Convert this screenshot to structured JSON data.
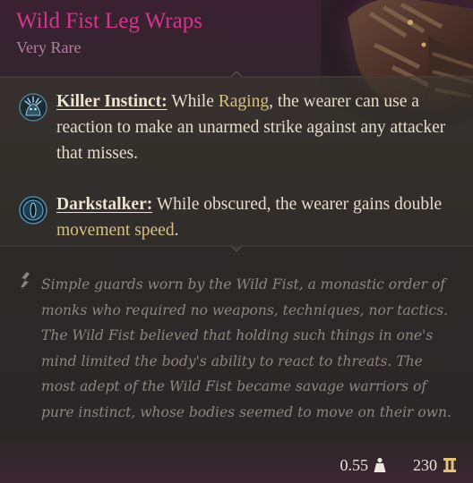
{
  "item": {
    "name": "Wild Fist Leg Wraps",
    "rarity": "Very Rare"
  },
  "passives": [
    {
      "icon": "killer-instinct-icon",
      "name": "Killer Instinct:",
      "pre": " While ",
      "keyword": "Raging",
      "post": ", the wearer can use a reaction to make an unarmed strike against any attacker that misses."
    },
    {
      "icon": "darkstalker-eye-icon",
      "name": "Darkstalker:",
      "pre": " While obscured, the wearer gains double ",
      "keyword": "movement speed",
      "post": "."
    }
  ],
  "lore": "Simple guards worn by the Wild Fist, a monastic order of monks who required no weapons, techniques, nor tactics. The Wild Fist believed that holding such things in one's mind limited the body's ability to react to threats. The most adept of the Wild Fist became savage warriors of pure instinct, whose bodies seemed to move on their own.",
  "footer": {
    "weight": "0.55",
    "weight_icon": "weight-icon",
    "value": "230",
    "value_icon": "gold-coin-icon"
  },
  "colors": {
    "title": "#d6358f",
    "rarity": "#b0829e",
    "keyword": "#d8c083",
    "lore": "#8d8680"
  }
}
